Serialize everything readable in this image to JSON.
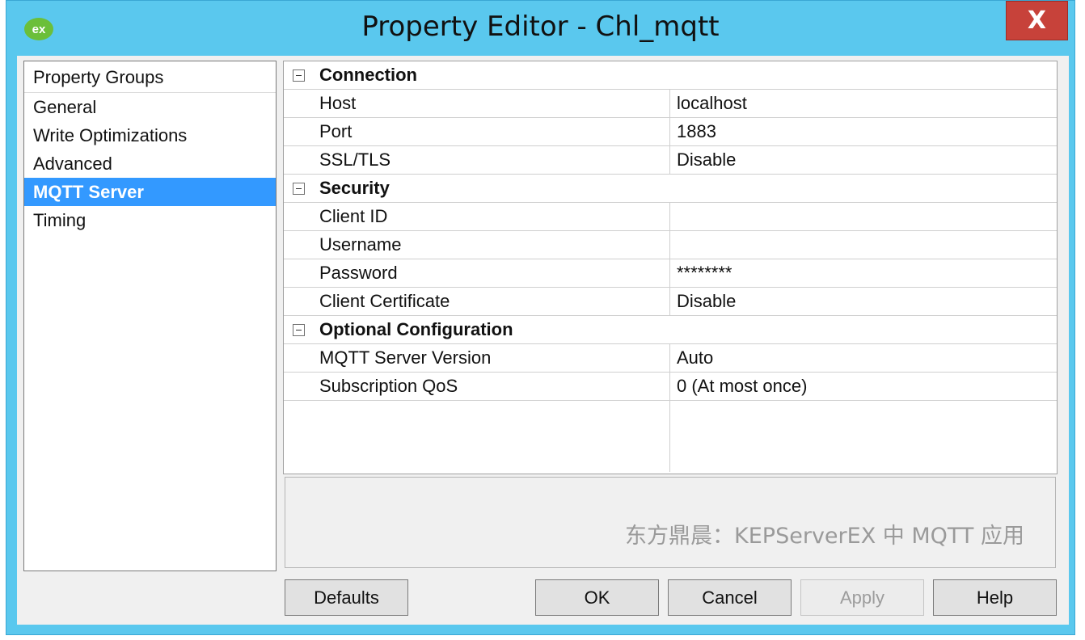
{
  "window": {
    "logo": "ex",
    "title": "Property Editor - Chl_mqtt",
    "close_label": "X"
  },
  "groups": {
    "header": "Property Groups",
    "items": [
      {
        "label": "General"
      },
      {
        "label": "Write Optimizations"
      },
      {
        "label": "Advanced"
      },
      {
        "label": "MQTT Server",
        "selected": true
      },
      {
        "label": "Timing"
      }
    ]
  },
  "properties": [
    {
      "category": "Connection",
      "rows": [
        {
          "name": "Host",
          "value": "localhost"
        },
        {
          "name": "Port",
          "value": "1883"
        },
        {
          "name": "SSL/TLS",
          "value": "Disable"
        }
      ]
    },
    {
      "category": "Security",
      "rows": [
        {
          "name": "Client ID",
          "value": ""
        },
        {
          "name": "Username",
          "value": ""
        },
        {
          "name": "Password",
          "value": "********"
        },
        {
          "name": "Client Certificate",
          "value": "Disable"
        }
      ]
    },
    {
      "category": "Optional Configuration",
      "rows": [
        {
          "name": "MQTT Server Version",
          "value": "Auto"
        },
        {
          "name": "Subscription QoS",
          "value": "0 (At most once)"
        }
      ]
    }
  ],
  "description": {
    "watermark": "东方鼎晨：KEPServerEX 中 MQTT 应用"
  },
  "buttons": {
    "defaults": "Defaults",
    "ok": "OK",
    "cancel": "Cancel",
    "apply": "Apply",
    "help": "Help"
  },
  "colors": {
    "titlebar": "#5ac8ee",
    "selection": "#3399ff",
    "close": "#c7423a"
  }
}
